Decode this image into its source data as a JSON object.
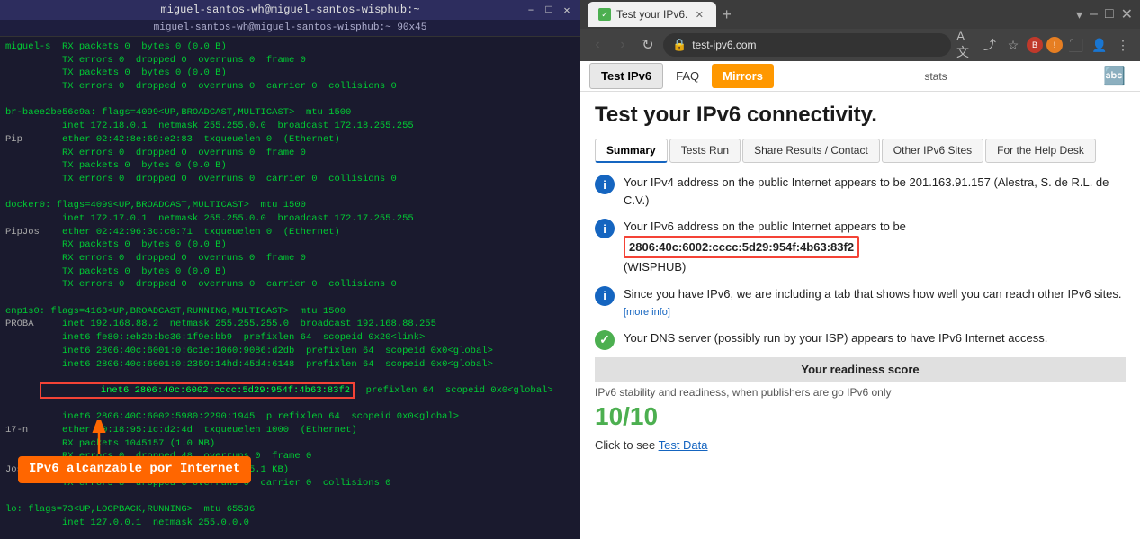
{
  "terminal": {
    "title": "miguel-santos-wh@miguel-santos-wisphub:~",
    "subtitle": "miguel-santos-wh@miguel-santos-wisphub:~ 90x45",
    "controls": [
      "–",
      "□",
      "✕"
    ],
    "lines": [
      "miguel-s  RX packets 0  bytes 0 (0.0 B)",
      "          TX errors 0  dropped 0  overruns 0  frame 0",
      "          TX packets 0  bytes 0 (0.0 B)",
      "          TX errors 0  dropped 0  overruns 0  carrier 0  collisions 0",
      "",
      "br-baee2be56c9a: flags=4099<UP,BROADCAST,MULTICAST>  mtu 1500",
      "          inet 172.18.0.1  netmask 255.255.0.0  broadcast 172.18.255.255",
      "Pip       ether 02:42:8e:69:e2:83  txqueuelen 0  (Ethernet)",
      "          RX errors 0  dropped 0  overruns 0  frame 0",
      "          TX packets 0  bytes 0 (0.0 B)",
      "          TX errors 0  dropped 0  overruns 0  carrier 0  collisions 0",
      "",
      "docker0: flags=4099<UP,BROADCAST,MULTICAST>  mtu 1500",
      "          inet 172.17.0.1  netmask 255.255.0.0  broadcast 172.17.255.255",
      "PipJos    ether 02:42:96:3c:c0:71  txqueuelen 0  (Ethernet)",
      "          RX packets 0  bytes 0 (0.0 B)",
      "          RX errors 0  dropped 0  overruns 0  frame 0",
      "          TX packets 0  bytes 0 (0.0 B)",
      "          TX errors 0  dropped 0  overruns 0  carrier 0  collisions 0",
      "",
      "enp1s0: flags=4163<UP,BROADCAST,RUNNING,MULTICAST>  mtu 1500",
      "PROBA     inet 192.168.88.2  netmask 255.255.255.0  broadcast 192.168.88.255",
      "          inet6 fe80::eb2b:bc36:1f9e:bb9  prefixlen 64  scopeid 0x20<link>",
      "          inet6 2806:40c:6001:0:6c1e:1060:9086:d2db  prefixlen 64  scopeid 0x0<global>",
      "          inet6 2806:40c:6001:0:2359:14hd:45d4:6148  prefixlen 64  scopeid 0x0<global>",
      "          inet6 2806:40c:6002:cccc:5d29:954f:4b63:83f2  prefixlen 64  scopeid 0x0<global>",
      "          inet6 2806:40C:6002:5980:2290:1945  p refixlen 64  scopeid 0x0<global>",
      "17-n      ether 60:18:95:1c:d2:4d  txqueuelen 1000  (Ethernet)",
      "          RX packets 1045157 (1.0 MB)",
      "          RX errors 0  dropped 48  overruns 0  frame 0",
      "Jose      TX packets 1853  bytes 305188 (305.1 KB)",
      "          TX errors 8  dropped 0 overruns 0  carrier 0  collisions 0",
      "",
      "lo: flags=73<UP,LOOPBACK,RUNNING>  mtu 65536",
      "          inet 127.0.0.1  netmask 255.0.0.0"
    ],
    "highlight_line": "          inet6 2806:40c:6002:cccc:5d29:954f:4b63:83f2  prefixlen 64  scopeid 0x0<global>",
    "arrow_label": "IPv6 alcanzable por Internet"
  },
  "browser": {
    "tab_title": "Test your IPv6.",
    "url": "test-ipv6.com",
    "win_controls": [
      "–",
      "□",
      "✕"
    ],
    "nav_buttons": [
      "‹",
      "›",
      "↻",
      "⊕"
    ],
    "site_nav": {
      "items": [
        {
          "label": "Test IPv6",
          "active": true
        },
        {
          "label": "FAQ",
          "active": false
        },
        {
          "label": "Mirrors",
          "active": false,
          "highlight": true
        }
      ],
      "stats": "stats"
    },
    "page": {
      "heading": "Test your IPv6 connectivity.",
      "tabs": [
        {
          "label": "Summary",
          "active": true
        },
        {
          "label": "Tests Run",
          "active": false
        },
        {
          "label": "Share Results / Contact",
          "active": false
        },
        {
          "label": "Other IPv6 Sites",
          "active": false
        },
        {
          "label": "For the Help Desk",
          "active": false
        }
      ],
      "cards": [
        {
          "type": "info",
          "color": "blue",
          "text": "Your IPv4 address on the public Internet appears to be 201.163.91.157 (Alestra, S. de R.L. de C.V.)"
        },
        {
          "type": "info",
          "color": "blue",
          "text": "Your IPv6 address on the public Internet appears to be",
          "ip": "2806:40c:6002:cccc:5d29:954f:4b63:83f2",
          "ip_extra": "(WISPHUB)"
        },
        {
          "type": "info",
          "color": "blue",
          "text": "Since you have IPv6, we are including a tab that shows how well you can reach other IPv6 sites.",
          "more_info": "more info"
        },
        {
          "type": "check",
          "color": "green",
          "text": "Your DNS server (possibly run by your ISP) appears to have IPv6 Internet access."
        }
      ],
      "readiness_bar_label": "Your readiness score",
      "readiness_sub": "IPv6 stability and readiness, when publishers are go IPv6 only",
      "score": "10/10",
      "test_data_prefix": "Click to see",
      "test_data_link": "Test Data"
    }
  }
}
